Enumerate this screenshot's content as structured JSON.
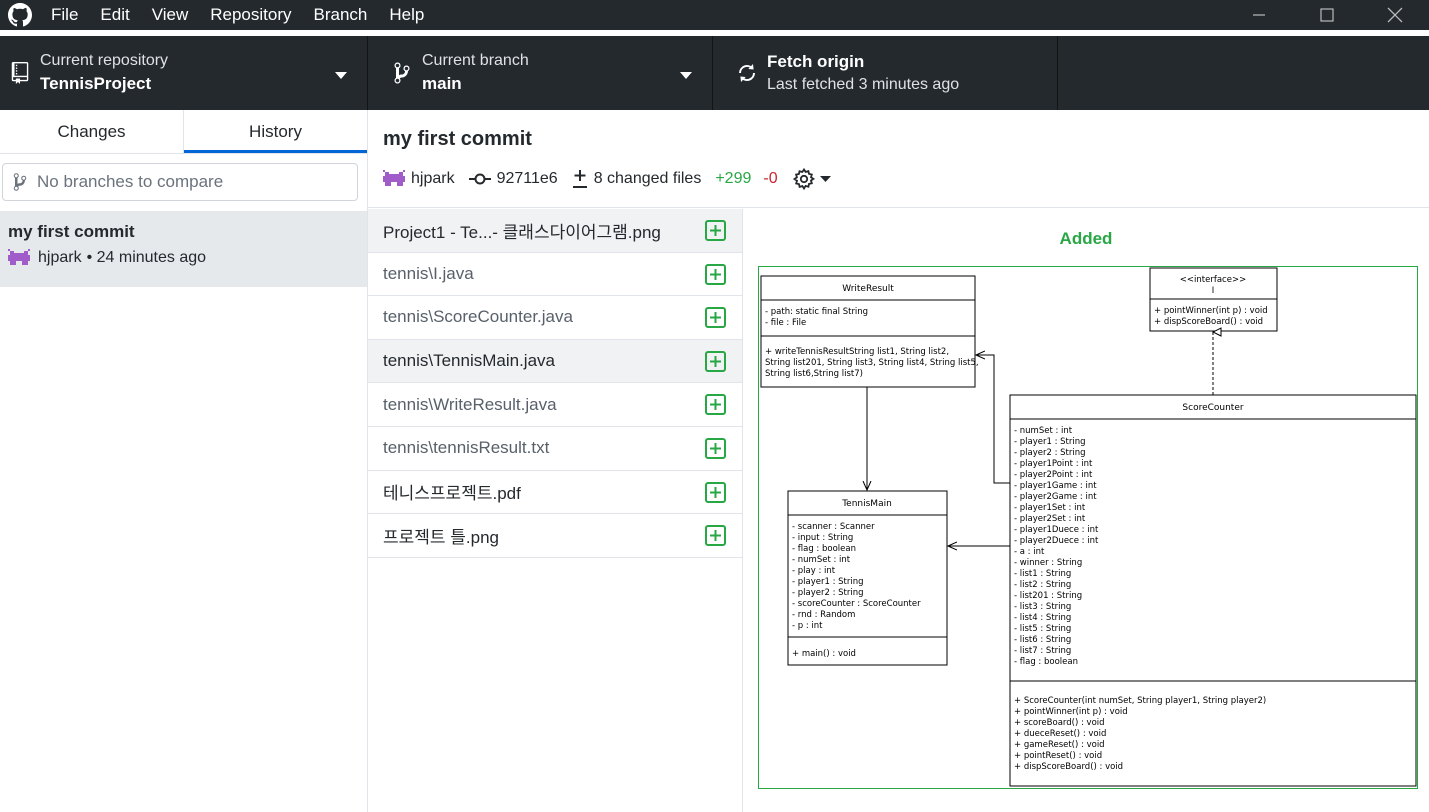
{
  "menu": [
    "File",
    "Edit",
    "View",
    "Repository",
    "Branch",
    "Help"
  ],
  "toolbar": {
    "repo_label": "Current repository",
    "repo_value": "TennisProject",
    "branch_label": "Current branch",
    "branch_value": "main",
    "fetch_title": "Fetch origin",
    "fetch_sub": "Last fetched 3 minutes ago"
  },
  "sidebar": {
    "tab_changes": "Changes",
    "tab_history": "History",
    "compare_placeholder": "No branches to compare",
    "commit": {
      "title": "my first commit",
      "author": "hjpark",
      "time": "• 24 minutes ago"
    }
  },
  "commit": {
    "title": "my first commit",
    "author": "hjpark",
    "sha": "92711e6",
    "changed_files": "8 changed files",
    "additions": "+299",
    "deletions": "-0"
  },
  "files": [
    "Project1 - Te...- 클래스다이어그램.png",
    "tennis\\I.java",
    "tennis\\ScoreCounter.java",
    "tennis\\TennisMain.java",
    "tennis\\WriteResult.java",
    "tennis\\tennisResult.txt",
    "테니스프로젝트.pdf",
    "프로젝트 틀.png"
  ],
  "diff": {
    "status": "Added",
    "uml": {
      "write_result": {
        "name": "WriteResult",
        "fields": [
          "- path: static final String",
          "- file : File"
        ],
        "methods": [
          "+ writeTennisResultString list1, String list2,",
          "String list201, String list3, String list4, String list5,",
          "String list6,String list7)"
        ]
      },
      "iface": {
        "stereotype": "<<interface>>",
        "name": "I",
        "methods": [
          "+ pointWinner(int p) : void",
          "+ dispScoreBoard() : void"
        ]
      },
      "score_counter": {
        "name": "ScoreCounter",
        "fields": [
          "- numSet : int",
          "- player1 : String",
          "- player2 : String",
          "- player1Point : int",
          "- player2Point : int",
          "- player1Game : int",
          "- player2Game : int",
          "- player1Set : int",
          "- player2Set : int",
          "- player1Duece : int",
          "- player2Duece : int",
          "- a : int",
          "- winner : String",
          "- list1 : String",
          "- list2 : String",
          "- list201 : String",
          "- list3 : String",
          "- list4 : String",
          "- list5 : String",
          "- list6 : String",
          "- list7 : String",
          "- flag : boolean"
        ],
        "methods": [
          "+ ScoreCounter(int numSet, String player1, String player2)",
          "+ pointWinner(int p) : void",
          "+ scoreBoard() : void",
          "+ dueceReset() : void",
          "+ gameReset() : void",
          "+ pointReset() : void",
          "+ dispScoreBoard() : void"
        ]
      },
      "tennis_main": {
        "name": "TennisMain",
        "fields": [
          "- scanner : Scanner",
          "- input : String",
          "- flag : boolean",
          "- numSet : int",
          "- play : int",
          "- player1 : String",
          "- player2 : String",
          "- scoreCounter : ScoreCounter",
          "- rnd : Random",
          "- p : int"
        ],
        "methods": [
          "+ main() : void"
        ]
      }
    }
  },
  "colors": {
    "titlebar": "#24292e",
    "accent": "#0366d6",
    "added": "#28a745",
    "removed": "#cb2431"
  },
  "icons": [
    "github-logo-icon",
    "minimize-icon",
    "maximize-icon",
    "close-icon",
    "repo-icon",
    "branch-icon",
    "sync-icon",
    "caret-down-icon",
    "git-compare-icon",
    "avatar-icon",
    "commit-icon",
    "diff-icon",
    "gear-icon",
    "file-added-icon"
  ]
}
